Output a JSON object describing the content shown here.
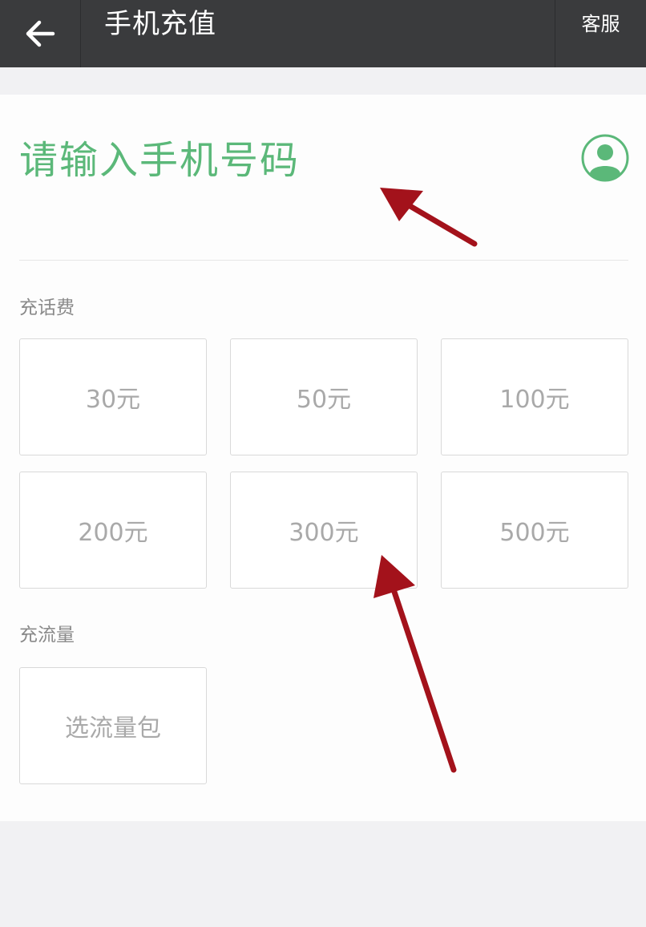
{
  "header": {
    "title": "手机充值",
    "service_label": "客服",
    "back_icon": "arrow-left-icon"
  },
  "phone": {
    "placeholder": "请输入手机号码",
    "contact_icon": "person-icon",
    "accent_color": "#5bb879"
  },
  "recharge": {
    "label": "充话费",
    "options": [
      "30元",
      "50元",
      "100元",
      "200元",
      "300元",
      "500元"
    ]
  },
  "data_plan": {
    "label": "充流量",
    "option": "选流量包"
  },
  "annotations": {
    "arrow_color": "#a3121b"
  }
}
